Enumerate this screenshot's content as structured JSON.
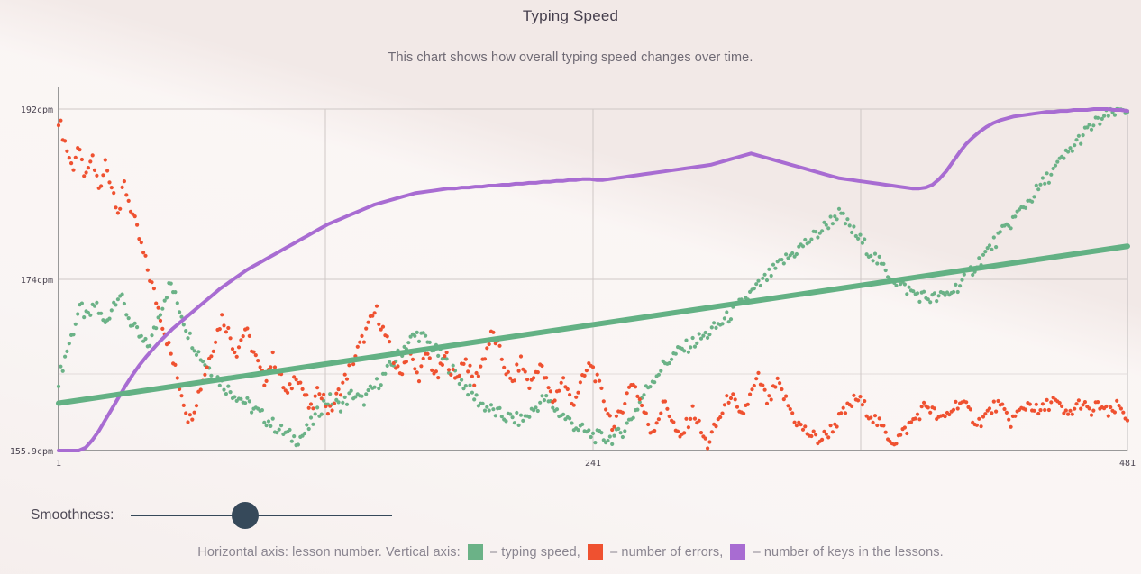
{
  "header": {
    "title": "Typing Speed",
    "subtitle": "This chart shows how overall typing speed changes over time."
  },
  "controls": {
    "smoothness_label": "Smoothness:",
    "slider_value": 44
  },
  "legend": {
    "prefix": "Horizontal axis: lesson number. Vertical axis: ",
    "speed_label": " – typing speed, ",
    "errors_label": " – number of errors, ",
    "keys_label": " – number of keys in the lessons."
  },
  "colors": {
    "background": "#f2e9e7",
    "speed": "#6bb287",
    "errors": "#ef5130",
    "keys": "#a86cd2",
    "trend": "#63b184",
    "axis": "#999999",
    "grid": "#cfc8c6",
    "slider": "#36495a"
  },
  "chart_data": {
    "type": "scatter",
    "title": "Typing Speed",
    "subtitle": "This chart shows how overall typing speed changes over time.",
    "xlabel": "lesson number",
    "ylabel": "cpm",
    "grid": true,
    "legend_position": "bottom",
    "xlim": [
      1,
      481
    ],
    "ylim": [
      155.9,
      192
    ],
    "xticks": [
      1,
      241,
      481
    ],
    "xticklabels": [
      "1",
      "241",
      "481"
    ],
    "yticks": [
      155.9,
      174,
      192
    ],
    "yticklabels": [
      "155.9cpm",
      "174cpm",
      "192cpm"
    ],
    "series": [
      {
        "name": "typing speed",
        "color": "#6bb287",
        "style": "dots",
        "values": [
          163.4,
          165.1,
          166.9,
          168.3,
          170.2,
          171.0,
          169.8,
          170.4,
          171.6,
          170.1,
          169.2,
          170.5,
          171.8,
          172.6,
          171.2,
          170.0,
          168.9,
          168.2,
          167.4,
          166.9,
          167.8,
          169.3,
          171.1,
          172.4,
          173.6,
          172.1,
          170.8,
          169.4,
          168.0,
          167.1,
          166.2,
          165.4,
          164.8,
          164.1,
          163.6,
          163.0,
          162.5,
          162.1,
          161.8,
          161.4,
          161.0,
          160.6,
          160.2,
          159.8,
          159.4,
          159.0,
          158.6,
          158.2,
          157.9,
          157.6,
          157.3,
          157.1,
          157.4,
          157.9,
          158.6,
          159.4,
          160.2,
          161.0,
          161.3,
          161.0,
          160.6,
          160.9,
          161.4,
          161.9,
          161.5,
          161.1,
          161.6,
          162.2,
          162.8,
          163.4,
          164.0,
          164.7,
          165.4,
          166.1,
          166.8,
          167.4,
          167.9,
          168.2,
          167.9,
          167.4,
          166.9,
          166.3,
          165.8,
          165.2,
          164.6,
          164.0,
          163.4,
          162.8,
          162.2,
          161.6,
          161.1,
          160.7,
          160.4,
          160.1,
          159.8,
          159.6,
          159.4,
          159.3,
          159.2,
          159.1,
          159.4,
          159.8,
          160.3,
          160.9,
          161.4,
          161.0,
          160.5,
          160.0,
          159.6,
          159.2,
          158.8,
          158.4,
          158.1,
          157.8,
          157.6,
          157.4,
          157.3,
          157.2,
          157.2,
          157.3,
          157.6,
          158.1,
          158.8,
          159.6,
          160.5,
          161.5,
          162.4,
          163.2,
          163.9,
          164.5,
          165.1,
          165.6,
          166.0,
          166.4,
          166.7,
          167.0,
          167.3,
          167.6,
          167.9,
          168.2,
          168.6,
          169.0,
          169.4,
          169.8,
          170.3,
          170.8,
          171.3,
          171.8,
          172.3,
          172.8,
          173.3,
          173.8,
          174.3,
          174.8,
          175.3,
          175.8,
          176.2,
          176.6,
          177.0,
          177.4,
          177.8,
          178.2,
          178.6,
          179.0,
          179.5,
          180.0,
          180.5,
          181.0,
          180.4,
          179.8,
          179.2,
          178.6,
          178.0,
          177.4,
          176.8,
          176.2,
          175.6,
          175.0,
          174.5,
          174.0,
          173.6,
          173.2,
          172.9,
          172.6,
          172.4,
          172.2,
          172.1,
          172.0,
          172.0,
          172.1,
          172.3,
          172.6,
          173.0,
          173.5,
          174.0,
          174.6,
          175.2,
          175.8,
          176.4,
          177.0,
          177.6,
          178.2,
          178.8,
          179.4,
          180.0,
          180.6,
          181.2,
          181.8,
          182.4,
          183.0,
          183.6,
          184.2,
          184.8,
          185.4,
          186.0,
          186.6,
          187.2,
          187.8,
          188.4,
          189.0,
          189.5,
          190.0,
          190.4,
          190.8,
          191.1,
          191.4,
          191.6,
          191.8,
          191.9,
          192.0
        ],
        "note": "noisy scatter rising from ~163 to ~192 cpm over 481 lessons with dips near lesson 60, 170, 310"
      },
      {
        "name": "number of errors",
        "color": "#ef5130",
        "style": "dots",
        "values": [
          191.0,
          189.2,
          187.4,
          185.6,
          188.0,
          186.2,
          184.4,
          187.0,
          185.1,
          183.2,
          186.4,
          184.6,
          182.8,
          181.0,
          184.2,
          182.4,
          180.6,
          178.8,
          177.0,
          175.2,
          173.4,
          171.6,
          169.8,
          168.0,
          166.2,
          164.4,
          162.6,
          160.8,
          159.0,
          160.4,
          162.0,
          163.6,
          165.2,
          166.8,
          168.4,
          170.0,
          169.0,
          167.6,
          166.2,
          167.5,
          168.8,
          167.4,
          166.0,
          164.6,
          163.2,
          164.5,
          165.8,
          164.4,
          163.0,
          161.6,
          162.9,
          164.2,
          162.8,
          161.4,
          160.0,
          161.3,
          162.6,
          161.2,
          159.8,
          160.9,
          162.0,
          163.1,
          164.2,
          165.3,
          166.4,
          167.5,
          168.6,
          169.7,
          170.8,
          169.4,
          168.0,
          166.6,
          165.2,
          163.8,
          165.1,
          166.4,
          165.0,
          163.6,
          164.9,
          166.2,
          164.8,
          163.4,
          164.7,
          166.0,
          164.6,
          163.2,
          164.5,
          165.8,
          164.4,
          163.0,
          164.3,
          165.6,
          167.0,
          168.4,
          167.0,
          165.6,
          164.2,
          162.8,
          164.1,
          165.4,
          164.0,
          162.6,
          163.9,
          165.2,
          163.8,
          162.4,
          161.0,
          162.3,
          163.6,
          162.2,
          160.8,
          161.9,
          163.0,
          164.1,
          165.2,
          163.8,
          162.4,
          161.0,
          159.6,
          158.2,
          159.5,
          160.8,
          162.1,
          163.4,
          162.0,
          160.6,
          159.2,
          157.8,
          158.9,
          160.0,
          161.1,
          159.7,
          158.3,
          156.9,
          158.0,
          159.1,
          160.2,
          158.8,
          157.4,
          156.5,
          157.6,
          158.7,
          159.8,
          160.9,
          162.0,
          160.6,
          159.2,
          160.3,
          161.4,
          162.5,
          163.6,
          162.2,
          160.8,
          161.9,
          163.0,
          162.0,
          161.0,
          160.0,
          159.0,
          158.4,
          158.0,
          157.6,
          157.3,
          157.0,
          157.4,
          157.9,
          158.5,
          159.1,
          159.7,
          160.3,
          160.9,
          161.5,
          160.9,
          160.3,
          159.7,
          159.1,
          158.5,
          157.9,
          157.3,
          156.9,
          157.3,
          157.8,
          158.4,
          159.0,
          159.6,
          160.2,
          160.8,
          160.2,
          159.6,
          159.0,
          159.5,
          160.0,
          160.6,
          161.2,
          160.6,
          160.0,
          159.4,
          158.8,
          159.3,
          159.8,
          160.3,
          160.8,
          160.2,
          159.6,
          159.0,
          159.5,
          160.0,
          160.5,
          161.0,
          160.4,
          159.8,
          160.3,
          160.8,
          161.3,
          160.7,
          160.1,
          159.5,
          160.0,
          160.5,
          161.0,
          160.4,
          159.8,
          160.3,
          160.8,
          160.2,
          159.6,
          160.1,
          160.6,
          160.0,
          159.4
        ],
        "note": "noisy scatter falling from ~191 at lesson 1 down to ~158 by lesson 481"
      },
      {
        "name": "number of keys in the lessons",
        "color": "#a86cd2",
        "style": "line",
        "values": [
          155.9,
          155.9,
          155.9,
          155.9,
          156.2,
          157.0,
          158.0,
          159.2,
          160.4,
          161.6,
          162.8,
          163.9,
          164.9,
          165.8,
          166.6,
          167.4,
          168.1,
          168.8,
          169.4,
          170.0,
          170.6,
          171.2,
          171.8,
          172.4,
          173.0,
          173.5,
          174.0,
          174.5,
          175.0,
          175.4,
          175.8,
          176.2,
          176.6,
          177.0,
          177.4,
          177.8,
          178.2,
          178.6,
          179.0,
          179.4,
          179.8,
          180.1,
          180.4,
          180.7,
          181.0,
          181.3,
          181.6,
          181.9,
          182.1,
          182.3,
          182.5,
          182.7,
          182.9,
          183.1,
          183.2,
          183.3,
          183.4,
          183.5,
          183.6,
          183.6,
          183.7,
          183.7,
          183.8,
          183.8,
          183.9,
          183.9,
          184.0,
          184.0,
          184.1,
          184.1,
          184.2,
          184.2,
          184.3,
          184.3,
          184.4,
          184.4,
          184.5,
          184.5,
          184.6,
          184.6,
          184.5,
          184.5,
          184.6,
          184.7,
          184.8,
          184.9,
          185.0,
          185.1,
          185.2,
          185.3,
          185.4,
          185.5,
          185.6,
          185.7,
          185.8,
          185.9,
          186.0,
          186.1,
          186.3,
          186.5,
          186.7,
          186.9,
          187.1,
          187.3,
          187.1,
          186.9,
          186.7,
          186.5,
          186.3,
          186.1,
          185.9,
          185.7,
          185.5,
          185.3,
          185.1,
          184.9,
          184.7,
          184.6,
          184.5,
          184.4,
          184.3,
          184.2,
          184.1,
          184.0,
          183.9,
          183.8,
          183.7,
          183.6,
          183.6,
          183.7,
          184.0,
          184.6,
          185.4,
          186.4,
          187.4,
          188.3,
          189.0,
          189.6,
          190.1,
          190.5,
          190.8,
          191.0,
          191.2,
          191.3,
          191.4,
          191.5,
          191.6,
          191.7,
          191.7,
          191.8,
          191.8,
          191.9,
          191.9,
          191.9,
          192.0,
          192.0,
          192.0,
          191.9,
          191.9,
          191.8
        ],
        "note": "smooth rising curve from 155.9 at lesson 1 up to a plateau ~184, a bump ~187 near lesson 330, a dip ~183.6 near lesson 400, then climbing to ~192 at lesson 481"
      },
      {
        "name": "typing speed trend",
        "color": "#63b184",
        "style": "thick-line",
        "values": [
          160.9,
          177.5
        ],
        "note": "straight regression line from (1,160.9) to (481,177.5)"
      }
    ]
  }
}
